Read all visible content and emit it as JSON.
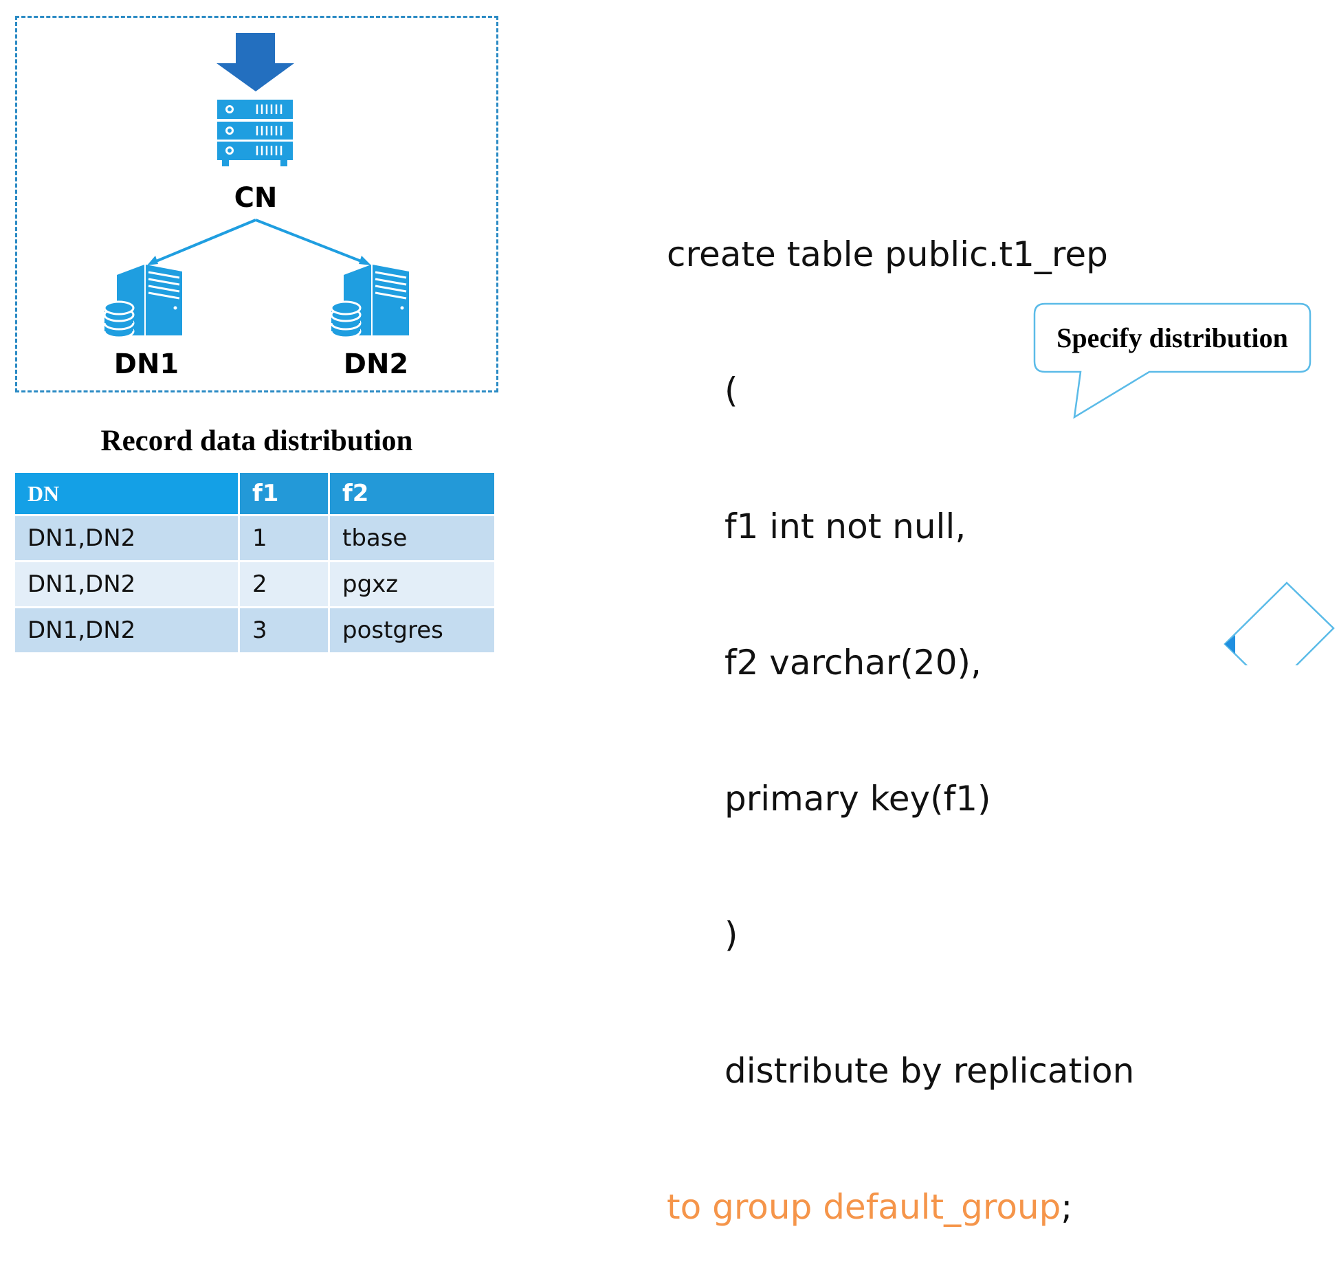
{
  "diagram": {
    "coordinator": {
      "label": "CN",
      "icon": "server-rack-icon"
    },
    "incoming_arrow": {
      "icon": "down-arrow-icon"
    },
    "data_nodes": [
      {
        "label": "DN1",
        "icon": "tower-server-database-icon"
      },
      {
        "label": "DN2",
        "icon": "tower-server-database-icon"
      }
    ],
    "colors": {
      "accent": "#1f9ee0",
      "arrow": "#236fbf",
      "dashed_border": "#2a8ac4"
    }
  },
  "distribution_table": {
    "title": "Record data distribution",
    "columns": [
      "DN",
      "f1",
      "f2"
    ],
    "rows": [
      {
        "dn": "DN1,DN2",
        "f1": "1",
        "f2": "tbase"
      },
      {
        "dn": "DN1,DN2",
        "f1": "2",
        "f2": "pgxz"
      },
      {
        "dn": "DN1,DN2",
        "f1": "3",
        "f2": "postgres"
      }
    ],
    "colors": {
      "header": "#2399d8",
      "header_first": "#14a0e6",
      "row_dark": "#c4dcf0",
      "row_light": "#e3eef8"
    }
  },
  "sql": {
    "lines": [
      "create table public.t1_rep",
      "(",
      "f1 int not null,",
      "f2 varchar(20),",
      "primary key(f1)",
      ")",
      "distribute by replication"
    ],
    "last_line_highlight": "to group default_group",
    "last_line_suffix": ";",
    "colors": {
      "text": "#111111",
      "highlight": "#f5954a"
    }
  },
  "callout": {
    "text": "Specify distribution",
    "border_color": "#5bbbe8"
  },
  "decoration": {
    "icon": "diamond-outline-icon",
    "color": "#5bbbe8"
  }
}
